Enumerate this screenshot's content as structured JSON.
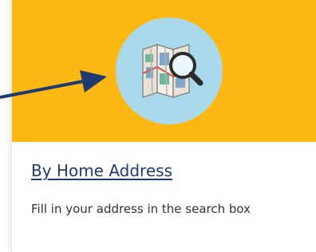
{
  "card": {
    "title": "By Home Address",
    "description": "Fill in your address in the search box",
    "icon": "map-magnifier-icon"
  },
  "colors": {
    "banner": "#FDB813",
    "icon_circle": "#A9D9EA",
    "title": "#1F3A70",
    "arrow": "#1F3A70"
  }
}
